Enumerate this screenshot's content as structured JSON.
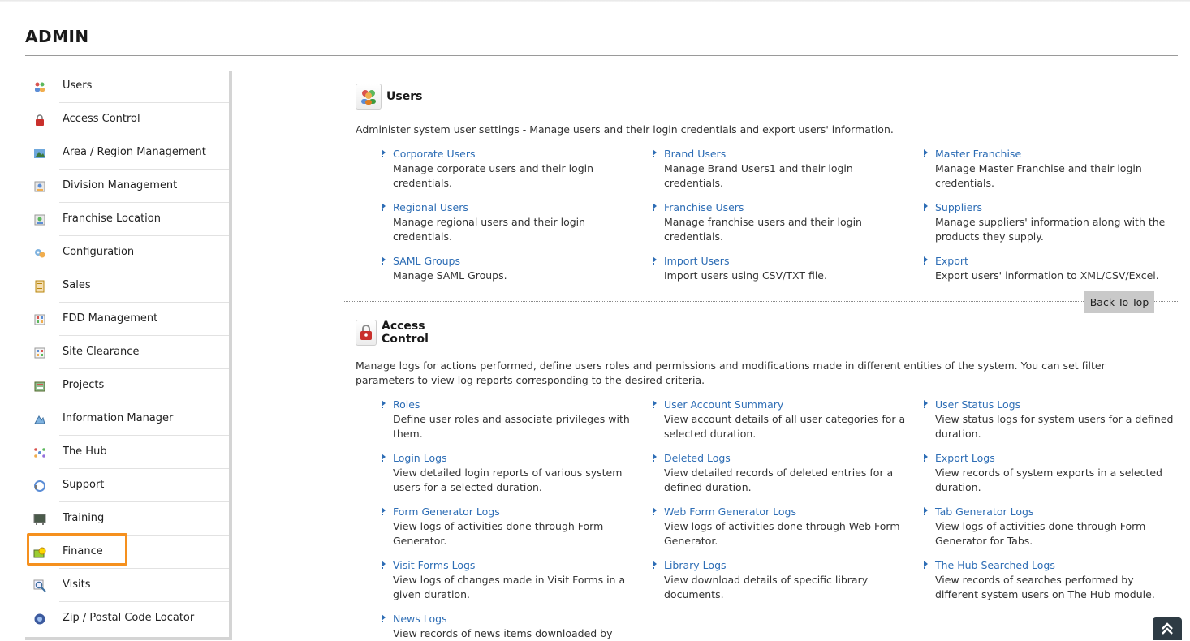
{
  "page": {
    "title": "ADMIN"
  },
  "sidebar": {
    "items": [
      {
        "label": "Users",
        "icon": "users-icon"
      },
      {
        "label": "Access Control",
        "icon": "access-control-icon"
      },
      {
        "label": "Area / Region Management",
        "icon": "area-region-icon"
      },
      {
        "label": "Division Management",
        "icon": "division-icon"
      },
      {
        "label": "Franchise Location",
        "icon": "franchise-location-icon"
      },
      {
        "label": "Configuration",
        "icon": "configuration-icon"
      },
      {
        "label": "Sales",
        "icon": "sales-icon"
      },
      {
        "label": "FDD Management",
        "icon": "fdd-icon"
      },
      {
        "label": "Site Clearance",
        "icon": "site-clearance-icon"
      },
      {
        "label": "Projects",
        "icon": "projects-icon"
      },
      {
        "label": "Information Manager",
        "icon": "information-manager-icon"
      },
      {
        "label": "The Hub",
        "icon": "hub-icon"
      },
      {
        "label": "Support",
        "icon": "support-icon"
      },
      {
        "label": "Training",
        "icon": "training-icon"
      },
      {
        "label": "Finance",
        "icon": "finance-icon"
      },
      {
        "label": "Visits",
        "icon": "visits-icon"
      },
      {
        "label": "Zip / Postal Code Locator",
        "icon": "zip-locator-icon"
      }
    ],
    "highlighted": "Finance",
    "highlight_color": "#f5901e"
  },
  "sections": {
    "users": {
      "title": "Users",
      "description": "Administer system user settings - Manage users and their login credentials and export users' information.",
      "links": [
        {
          "title": "Corporate Users",
          "desc": "Manage corporate users and their login credentials."
        },
        {
          "title": "Brand Users",
          "desc": "Manage Brand Users1 and their login credentials."
        },
        {
          "title": "Master Franchise",
          "desc": "Manage Master Franchise and their login credentials."
        },
        {
          "title": "Regional Users",
          "desc": "Manage regional users and their login credentials."
        },
        {
          "title": "Franchise Users",
          "desc": "Manage franchise users and their login credentials."
        },
        {
          "title": "Suppliers",
          "desc": "Manage suppliers' information along with the products they supply."
        },
        {
          "title": "SAML Groups",
          "desc": "Manage SAML Groups."
        },
        {
          "title": "Import Users",
          "desc": "Import users using CSV/TXT file."
        },
        {
          "title": "Export",
          "desc": "Export users' information to XML/CSV/Excel."
        }
      ]
    },
    "access_control": {
      "title": "Access Control",
      "description": "Manage logs for actions performed, define users roles and permissions and modifications made in different entities of the system. You can set filter parameters to view log reports corresponding to the desired criteria.",
      "links": [
        {
          "title": "Roles",
          "desc": "Define user roles and associate privileges with them."
        },
        {
          "title": "User Account Summary",
          "desc": "View account details of all user categories for a selected duration."
        },
        {
          "title": "User Status Logs",
          "desc": "View status logs for system users for a defined duration."
        },
        {
          "title": "Login Logs",
          "desc": "View detailed login reports of various system users for a selected duration."
        },
        {
          "title": "Deleted Logs",
          "desc": "View detailed records of deleted entries for a defined duration."
        },
        {
          "title": "Export Logs",
          "desc": "View records of system exports in a selected duration."
        },
        {
          "title": "Form Generator Logs",
          "desc": "View logs of activities done through Form Generator."
        },
        {
          "title": "Web Form Generator Logs",
          "desc": "View logs of activities done through Web Form Generator."
        },
        {
          "title": "Tab Generator Logs",
          "desc": "View logs of activities done through Form Generator for Tabs."
        },
        {
          "title": "Visit Forms Logs",
          "desc": "View logs of changes made in Visit Forms in a given duration."
        },
        {
          "title": "Library Logs",
          "desc": "View download details of specific library documents."
        },
        {
          "title": "The Hub Searched Logs",
          "desc": "View records of searches performed by different system users on The Hub module."
        },
        {
          "title": "News Logs",
          "desc": "View records of news items downloaded by"
        }
      ]
    }
  },
  "back_to_top": "Back To Top",
  "colors": {
    "link": "#2d6db5",
    "sidebar_border": "#d4d4d4",
    "button_bg": "#c9c9c9",
    "scroll_button": "#2e3b44"
  }
}
